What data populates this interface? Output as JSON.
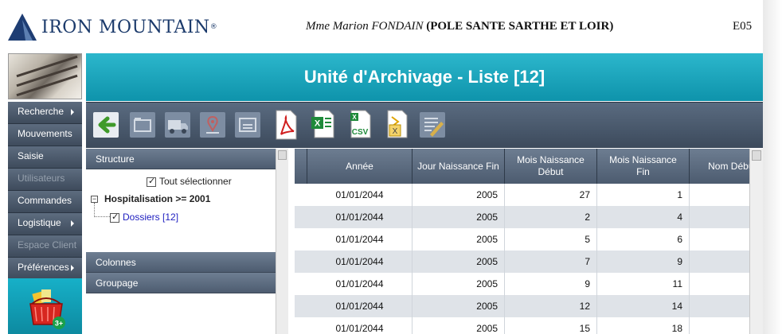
{
  "header": {
    "brand": "IRON MOUNTAIN",
    "user_name": "Mme Marion FONDAIN",
    "organisation": "(POLE SANTE SARTHE ET LOIR)",
    "code": "E05"
  },
  "nav": {
    "items": [
      {
        "label": "Recherche",
        "arrow": true,
        "enabled": true
      },
      {
        "label": "Mouvements",
        "arrow": false,
        "enabled": true
      },
      {
        "label": "Saisie",
        "arrow": false,
        "enabled": true
      },
      {
        "label": "Utilisateurs",
        "arrow": false,
        "enabled": false
      },
      {
        "label": "Commandes",
        "arrow": false,
        "enabled": true
      },
      {
        "label": "Logistique",
        "arrow": true,
        "enabled": true
      },
      {
        "label": "Espace Client",
        "arrow": false,
        "enabled": false
      },
      {
        "label": "Préférences",
        "arrow": true,
        "enabled": true
      }
    ],
    "basket_count": "3+"
  },
  "page": {
    "title": "Unité d'Archivage - Liste [12]"
  },
  "toolbar": {
    "icons": [
      "back-arrow-icon",
      "folder-icon",
      "truck-icon",
      "location-pin-icon",
      "card-icon",
      "pdf-export-icon",
      "excel-export-icon",
      "csv-export-icon",
      "xml-export-icon",
      "edit-list-icon"
    ],
    "csv_label": "CSV"
  },
  "left_panel": {
    "structure_label": "Structure",
    "select_all": "Tout sélectionner",
    "group_node": "Hospitalisation >= 2001",
    "child_node": "Dossiers [12]",
    "columns_label": "Colonnes",
    "grouping_label": "Groupage"
  },
  "grid": {
    "columns": [
      "Année",
      "Jour Naissance Fin",
      "Mois Naissance Début",
      "Mois Naissance Fin",
      "Nom Début"
    ],
    "rows": [
      [
        "01/01/2044",
        "2005",
        "27",
        "1",
        ""
      ],
      [
        "01/01/2044",
        "2005",
        "2",
        "4",
        ""
      ],
      [
        "01/01/2044",
        "2005",
        "5",
        "6",
        ""
      ],
      [
        "01/01/2044",
        "2005",
        "7",
        "9",
        ""
      ],
      [
        "01/01/2044",
        "2005",
        "9",
        "11",
        ""
      ],
      [
        "01/01/2044",
        "2005",
        "12",
        "14",
        ""
      ],
      [
        "01/01/2044",
        "2005",
        "15",
        "18",
        ""
      ]
    ]
  },
  "colors": {
    "accent": "#1fa7be",
    "nav": "#4b596b",
    "header_grid": "#5a6a7e"
  }
}
